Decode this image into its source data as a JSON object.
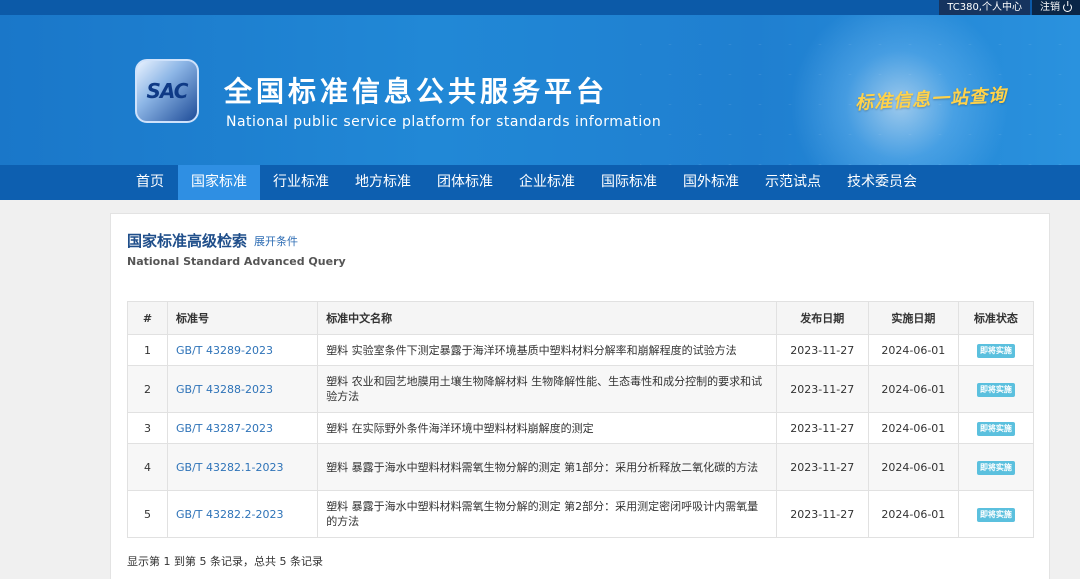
{
  "topbar": {
    "user": "TC380,个人中心",
    "logout": "注销"
  },
  "banner": {
    "logo_text": "SAC",
    "title_cn": "全国标准信息公共服务平台",
    "title_en": "National public service platform  for standards information",
    "slogan": "标准信息一站查询"
  },
  "nav": {
    "items": [
      "首页",
      "国家标准",
      "行业标准",
      "地方标准",
      "团体标准",
      "企业标准",
      "国际标准",
      "国外标准",
      "示范试点",
      "技术委员会"
    ],
    "active_index": 1
  },
  "panel": {
    "title": "国家标准高级检索",
    "expand_link": "展开条件",
    "subtitle": "National Standard Advanced Query"
  },
  "table": {
    "headers": [
      "#",
      "标准号",
      "标准中文名称",
      "发布日期",
      "实施日期",
      "标准状态"
    ],
    "rows": [
      {
        "idx": "1",
        "code": "GB/T 43289-2023",
        "name": "塑料 实验室条件下测定暴露于海洋环境基质中塑料材料分解率和崩解程度的试验方法",
        "published": "2023-11-27",
        "implemented": "2024-06-01",
        "status": "即将实施"
      },
      {
        "idx": "2",
        "code": "GB/T 43288-2023",
        "name": "塑料 农业和园艺地膜用土壤生物降解材料 生物降解性能、生态毒性和成分控制的要求和试验方法",
        "published": "2023-11-27",
        "implemented": "2024-06-01",
        "status": "即将实施"
      },
      {
        "idx": "3",
        "code": "GB/T 43287-2023",
        "name": "塑料 在实际野外条件海洋环境中塑料材料崩解度的测定",
        "published": "2023-11-27",
        "implemented": "2024-06-01",
        "status": "即将实施"
      },
      {
        "idx": "4",
        "code": "GB/T 43282.1-2023",
        "name": "塑料 暴露于海水中塑料材料需氧生物分解的测定 第1部分：采用分析释放二氧化碳的方法",
        "published": "2023-11-27",
        "implemented": "2024-06-01",
        "status": "即将实施"
      },
      {
        "idx": "5",
        "code": "GB/T 43282.2-2023",
        "name": "塑料 暴露于海水中塑料材料需氧生物分解的测定 第2部分：采用测定密闭呼吸计内需氧量的方法",
        "published": "2023-11-27",
        "implemented": "2024-06-01",
        "status": "即将实施"
      }
    ]
  },
  "pagination": {
    "summary": "显示第 1 到第 5 条记录，总共 5 条记录"
  },
  "colors": {
    "nav_bg": "#0d5fb0",
    "nav_active": "#2f8fe3",
    "link": "#2e73b8",
    "badge": "#5bc0de"
  }
}
